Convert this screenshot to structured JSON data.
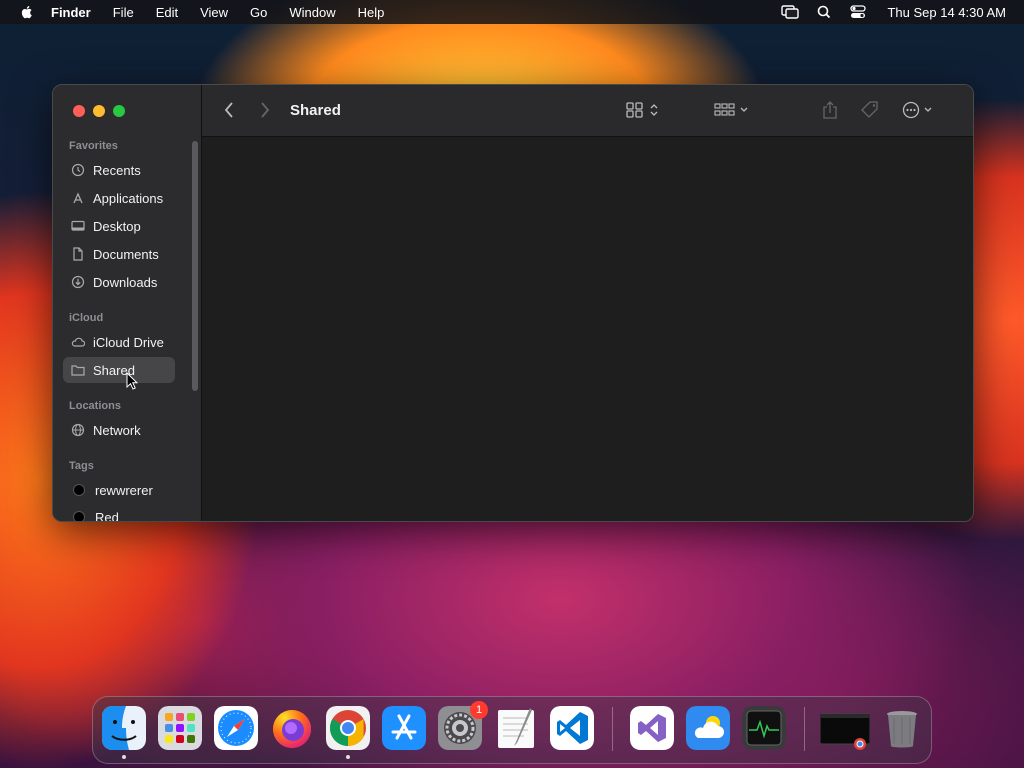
{
  "menubar": {
    "app_name": "Finder",
    "menus": [
      "File",
      "Edit",
      "View",
      "Go",
      "Window",
      "Help"
    ],
    "clock": "Thu Sep 14  4:30 AM",
    "icons": [
      "screen-mirroring-icon",
      "spotlight-search-icon",
      "control-center-icon"
    ]
  },
  "window": {
    "title": "Shared",
    "sidebar": {
      "favorites_header": "Favorites",
      "favorites": [
        {
          "label": "Recents",
          "icon": "clock-icon"
        },
        {
          "label": "Applications",
          "icon": "applications-icon"
        },
        {
          "label": "Desktop",
          "icon": "desktop-icon"
        },
        {
          "label": "Documents",
          "icon": "document-icon"
        },
        {
          "label": "Downloads",
          "icon": "download-icon"
        }
      ],
      "icloud_header": "iCloud",
      "icloud": [
        {
          "label": "iCloud Drive",
          "icon": "cloud-icon"
        },
        {
          "label": "Shared",
          "icon": "shared-folder-icon",
          "selected": true
        }
      ],
      "locations_header": "Locations",
      "locations": [
        {
          "label": "Network",
          "icon": "globe-icon"
        }
      ],
      "tags_header": "Tags",
      "tags": [
        {
          "label": "rewwrerer",
          "color": "#000000"
        },
        {
          "label": "Red",
          "color": "#000000"
        }
      ]
    }
  },
  "dock": {
    "apps": [
      {
        "name": "Finder",
        "icon": "finder-icon",
        "running": true
      },
      {
        "name": "Launchpad",
        "icon": "launchpad-icon"
      },
      {
        "name": "Safari",
        "icon": "safari-icon"
      },
      {
        "name": "Firefox",
        "icon": "firefox-icon"
      },
      {
        "name": "Google Chrome",
        "icon": "chrome-icon",
        "running": true
      },
      {
        "name": "App Store",
        "icon": "app-store-icon"
      },
      {
        "name": "System Settings",
        "icon": "system-settings-icon",
        "badge": "1"
      },
      {
        "name": "TextEdit",
        "icon": "textedit-icon"
      },
      {
        "name": "Visual Studio Code",
        "icon": "vscode-icon"
      },
      {
        "name": "Visual Studio",
        "icon": "visual-studio-icon"
      },
      {
        "name": "Weather",
        "icon": "weather-icon"
      },
      {
        "name": "Activity Monitor",
        "icon": "activity-monitor-icon"
      },
      {
        "name": "Chrome Window",
        "icon": "chrome-window-thumbnail-icon"
      },
      {
        "name": "Trash",
        "icon": "trash-icon"
      }
    ]
  },
  "colors": {
    "window_bg": "#1e1e1e",
    "sidebar_bg": "#2c2c2e",
    "selection": "#464649",
    "close": "#ff5f57",
    "minimize": "#febc2e",
    "zoom": "#28c840",
    "badge": "#ff3b30"
  }
}
